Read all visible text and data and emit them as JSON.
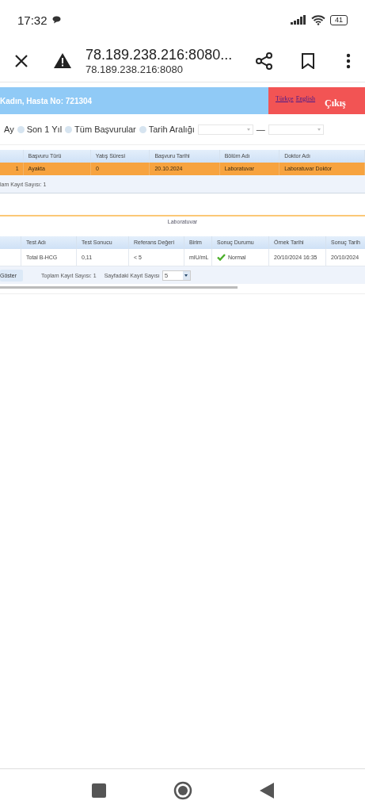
{
  "status_bar": {
    "time": "17:32",
    "battery": "41"
  },
  "browser": {
    "title": "78.189.238.216:8080...",
    "url": "78.189.238.216:8080"
  },
  "header": {
    "patient": "Kadın, Hasta No: 721304",
    "languages": [
      {
        "label": "Türkçe"
      },
      {
        "label": "English"
      }
    ],
    "logout": "Çıkış"
  },
  "filters": {
    "lead": "Ay",
    "options": [
      {
        "label": "Son 1 Yıl",
        "selected": false
      },
      {
        "label": "Tüm Başvurular",
        "selected": false
      },
      {
        "label": "Tarih Aralığı",
        "selected": false
      }
    ],
    "separator": "—"
  },
  "visits_table": {
    "columns": [
      "",
      "Başvuru Türü",
      "Yatış Süresi",
      "Başvuru Tarihi",
      "Bölüm Adı",
      "Doktor Adı"
    ],
    "rows": [
      {
        "selected": true,
        "cells": [
          "1",
          "Ayakta",
          "0",
          "20.10.2024",
          "Laboratuvar",
          "Laboratuvar Doktor"
        ]
      }
    ],
    "footer": "lam Kayıt Sayısı: 1"
  },
  "section_title": "Laboratuvar",
  "results_table": {
    "columns": [
      "",
      "Test Adı",
      "Test Sonucu",
      "Referans Değeri",
      "Birim",
      "Sonuç Durumu",
      "Örnek Tarihi",
      "Sonuç Tarih"
    ],
    "rows": [
      {
        "selected": false,
        "cells": [
          "",
          "Total B-HCG",
          "0,11",
          "< 5",
          "mIU/mL",
          "Normal",
          "20/10/2024 16:35",
          "20/10/2024"
        ],
        "status_ok": true
      }
    ],
    "show_button": "Göster",
    "total": "Toplam Kayıt Sayısı: 1",
    "page_size_label": "Sayfadaki Kayıt Sayısı",
    "page_size": "5"
  }
}
